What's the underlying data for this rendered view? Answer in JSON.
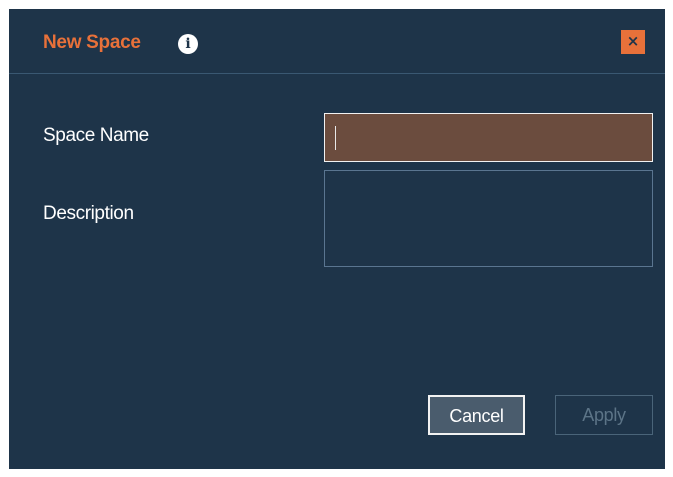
{
  "dialog": {
    "title": "New Space",
    "info_icon": "info-icon",
    "close_icon": "close-icon",
    "close_glyph": "×"
  },
  "form": {
    "space_name_label": "Space Name",
    "space_name_value": "",
    "description_label": "Description",
    "description_value": ""
  },
  "buttons": {
    "cancel_label": "Cancel",
    "apply_label": "Apply"
  },
  "colors": {
    "accent": "#e8713a",
    "background": "#1e3449",
    "active_input": "#6b4c3e"
  }
}
